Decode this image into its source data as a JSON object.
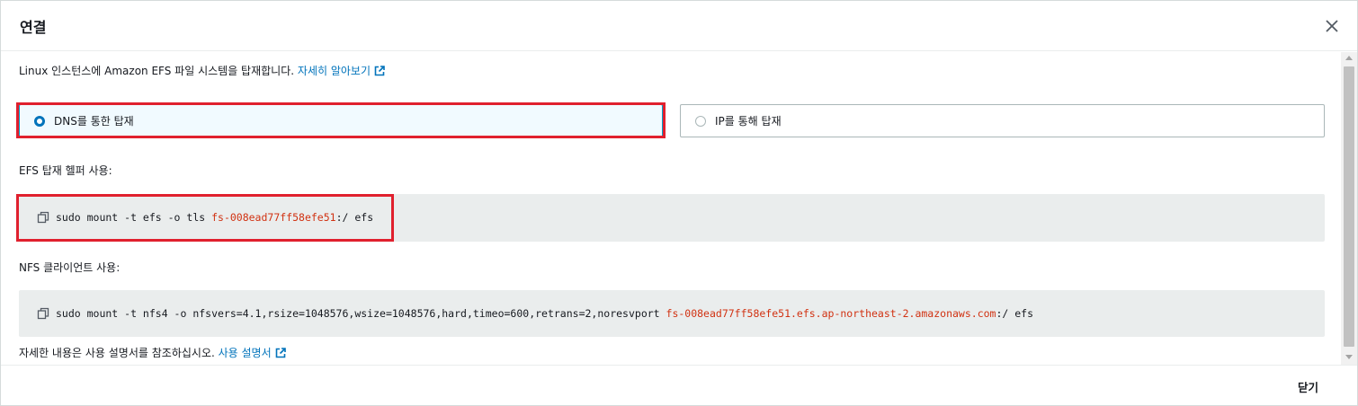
{
  "modal": {
    "title": "연결",
    "close_icon": "close-icon"
  },
  "intro": {
    "text": "Linux 인스턴스에 Amazon EFS 파일 시스템을 탑재합니다.",
    "learn_more": "자세히 알아보기"
  },
  "mount_options": [
    {
      "label": "DNS를 통한 탑재",
      "selected": true
    },
    {
      "label": "IP를 통해 탑재",
      "selected": false
    }
  ],
  "efs_helper": {
    "label": "EFS 탑재 헬퍼 사용:",
    "command_prefix": "sudo mount -t efs -o tls ",
    "command_fsid": "fs-008ead77ff58efe51",
    "command_suffix": ":/ efs"
  },
  "nfs_client": {
    "label": "NFS 클라이언트 사용:",
    "command_prefix": "sudo mount -t nfs4 -o nfsvers=4.1,rsize=1048576,wsize=1048576,hard,timeo=600,retrans=2,noresvport ",
    "command_fsid": "fs-008ead77ff58efe51.efs.ap-northeast-2.amazonaws.com",
    "command_suffix": ":/ efs"
  },
  "footer_note": {
    "text": "자세한 내용은 사용 설명서를 참조하십시오.",
    "link": "사용 설명서"
  },
  "footer": {
    "close_label": "닫기"
  },
  "colors": {
    "link": "#0073bb",
    "fsid": "#d13212",
    "highlight": "#e0202e",
    "selected_bg": "#f1faff"
  }
}
